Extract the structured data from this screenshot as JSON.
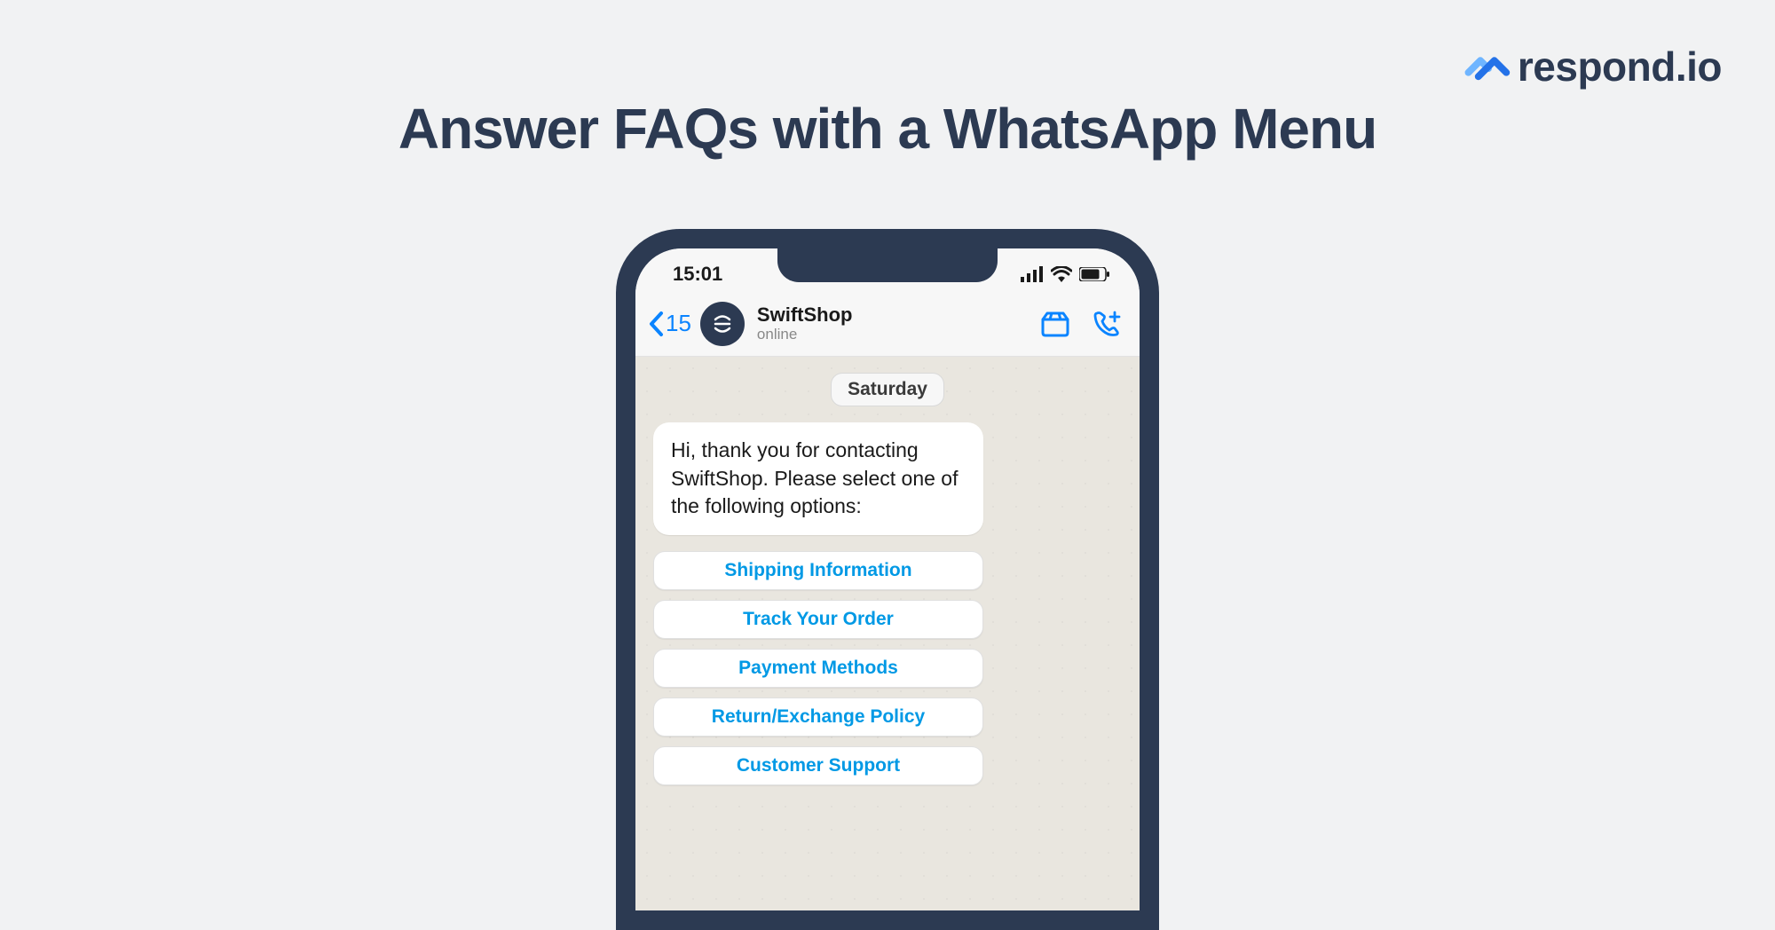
{
  "brand": {
    "name": "respond.io"
  },
  "page_title": "Answer FAQs with a WhatsApp Menu",
  "status_bar": {
    "time": "15:01"
  },
  "chat_header": {
    "back_count": "15",
    "contact_name": "SwiftShop",
    "status": "online"
  },
  "chat": {
    "date_label": "Saturday",
    "greeting": "Hi, thank you for contacting SwiftShop. Please select one of the following options:",
    "menu_options": [
      "Shipping Information",
      "Track Your Order",
      "Payment Methods",
      "Return/Exchange Policy",
      "Customer Support"
    ]
  }
}
